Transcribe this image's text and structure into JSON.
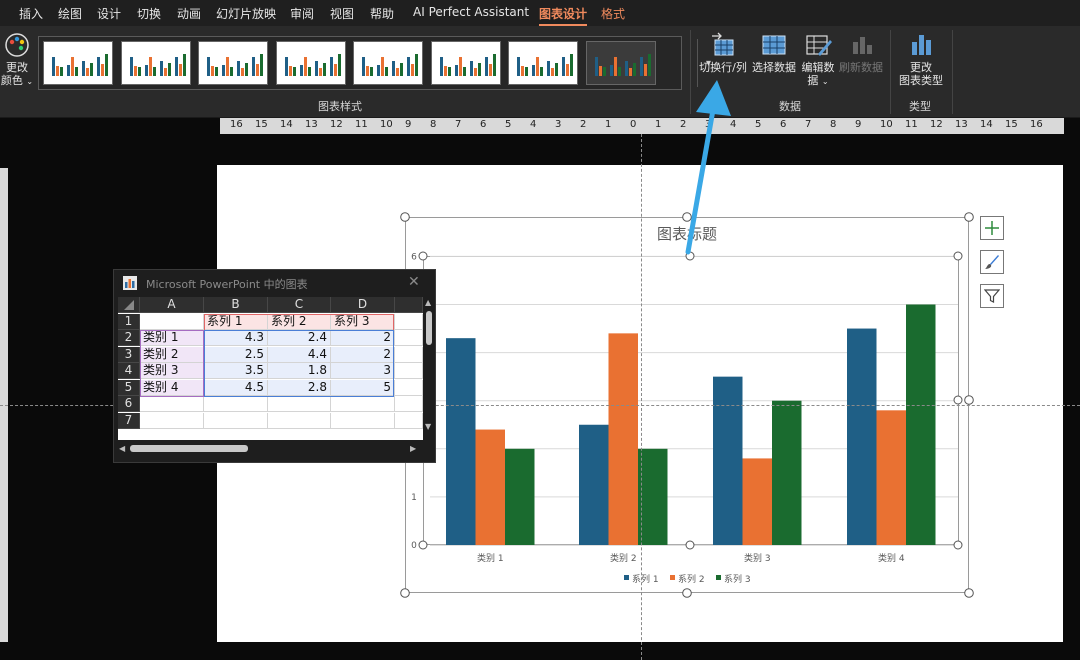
{
  "menu": {
    "tabs": [
      {
        "label": "插入",
        "active": false
      },
      {
        "label": "绘图",
        "active": false
      },
      {
        "label": "设计",
        "active": false
      },
      {
        "label": "切换",
        "active": false
      },
      {
        "label": "动画",
        "active": false
      },
      {
        "label": "幻灯片放映",
        "active": false
      },
      {
        "label": "审阅",
        "active": false
      },
      {
        "label": "视图",
        "active": false
      },
      {
        "label": "帮助",
        "active": false
      },
      {
        "label": "AI Perfect Assistant",
        "active": false
      },
      {
        "label": "图表设计",
        "active": true
      },
      {
        "label": "格式",
        "active": false
      }
    ]
  },
  "ribbon": {
    "change_colors_line1": "更改",
    "change_colors_line2": "颜色",
    "chart_styles_group": "图表样式",
    "data_group": "数据",
    "type_group": "类型",
    "switch_row_col": "切换行/列",
    "select_data": "选择数据",
    "edit_data_line1": "编辑数",
    "edit_data_line2": "据",
    "refresh_data": "刷新数据",
    "change_type_line1": "更改",
    "change_type_line2": "图表类型"
  },
  "ruler": {
    "labels": [
      "16",
      "15",
      "14",
      "13",
      "12",
      "11",
      "10",
      "9",
      "8",
      "7",
      "6",
      "5",
      "4",
      "3",
      "2",
      "1",
      "0",
      "1",
      "2",
      "3",
      "4",
      "5",
      "6",
      "7",
      "8",
      "9",
      "10",
      "11",
      "12",
      "13",
      "14",
      "15",
      "16"
    ]
  },
  "sheet": {
    "title": "Microsoft PowerPoint 中的图表",
    "columns": [
      "A",
      "B",
      "C",
      "D"
    ],
    "row_numbers": [
      "1",
      "2",
      "3",
      "4",
      "5",
      "6",
      "7"
    ],
    "header_row": [
      "",
      "系列 1",
      "系列 2",
      "系列 3"
    ],
    "rows": [
      {
        "label": "类别 1",
        "values": [
          "4.3",
          "2.4",
          "2"
        ]
      },
      {
        "label": "类别 2",
        "values": [
          "2.5",
          "4.4",
          "2"
        ]
      },
      {
        "label": "类别 3",
        "values": [
          "3.5",
          "1.8",
          "3"
        ]
      },
      {
        "label": "类别 4",
        "values": [
          "4.5",
          "2.8",
          "5"
        ]
      }
    ]
  },
  "colors": {
    "series1": "#1f5f86",
    "series2": "#e97132",
    "series3": "#1a6b2f",
    "accent_tab": "#f08a5d",
    "arrow": "#3aa8e6"
  },
  "chart_data": {
    "type": "bar",
    "title": "图表标题",
    "categories": [
      "类别 1",
      "类别 2",
      "类别 3",
      "类别 4"
    ],
    "series": [
      {
        "name": "系列 1",
        "values": [
          4.3,
          2.5,
          3.5,
          4.5
        ]
      },
      {
        "name": "系列 2",
        "values": [
          2.4,
          4.4,
          1.8,
          2.8
        ]
      },
      {
        "name": "系列 3",
        "values": [
          2,
          2,
          3,
          5
        ]
      }
    ],
    "ylim": [
      0,
      6
    ],
    "yticks": [
      "0",
      "1",
      "2",
      "3",
      "4",
      "5",
      "6"
    ],
    "grid": true,
    "legend": "bottom"
  }
}
